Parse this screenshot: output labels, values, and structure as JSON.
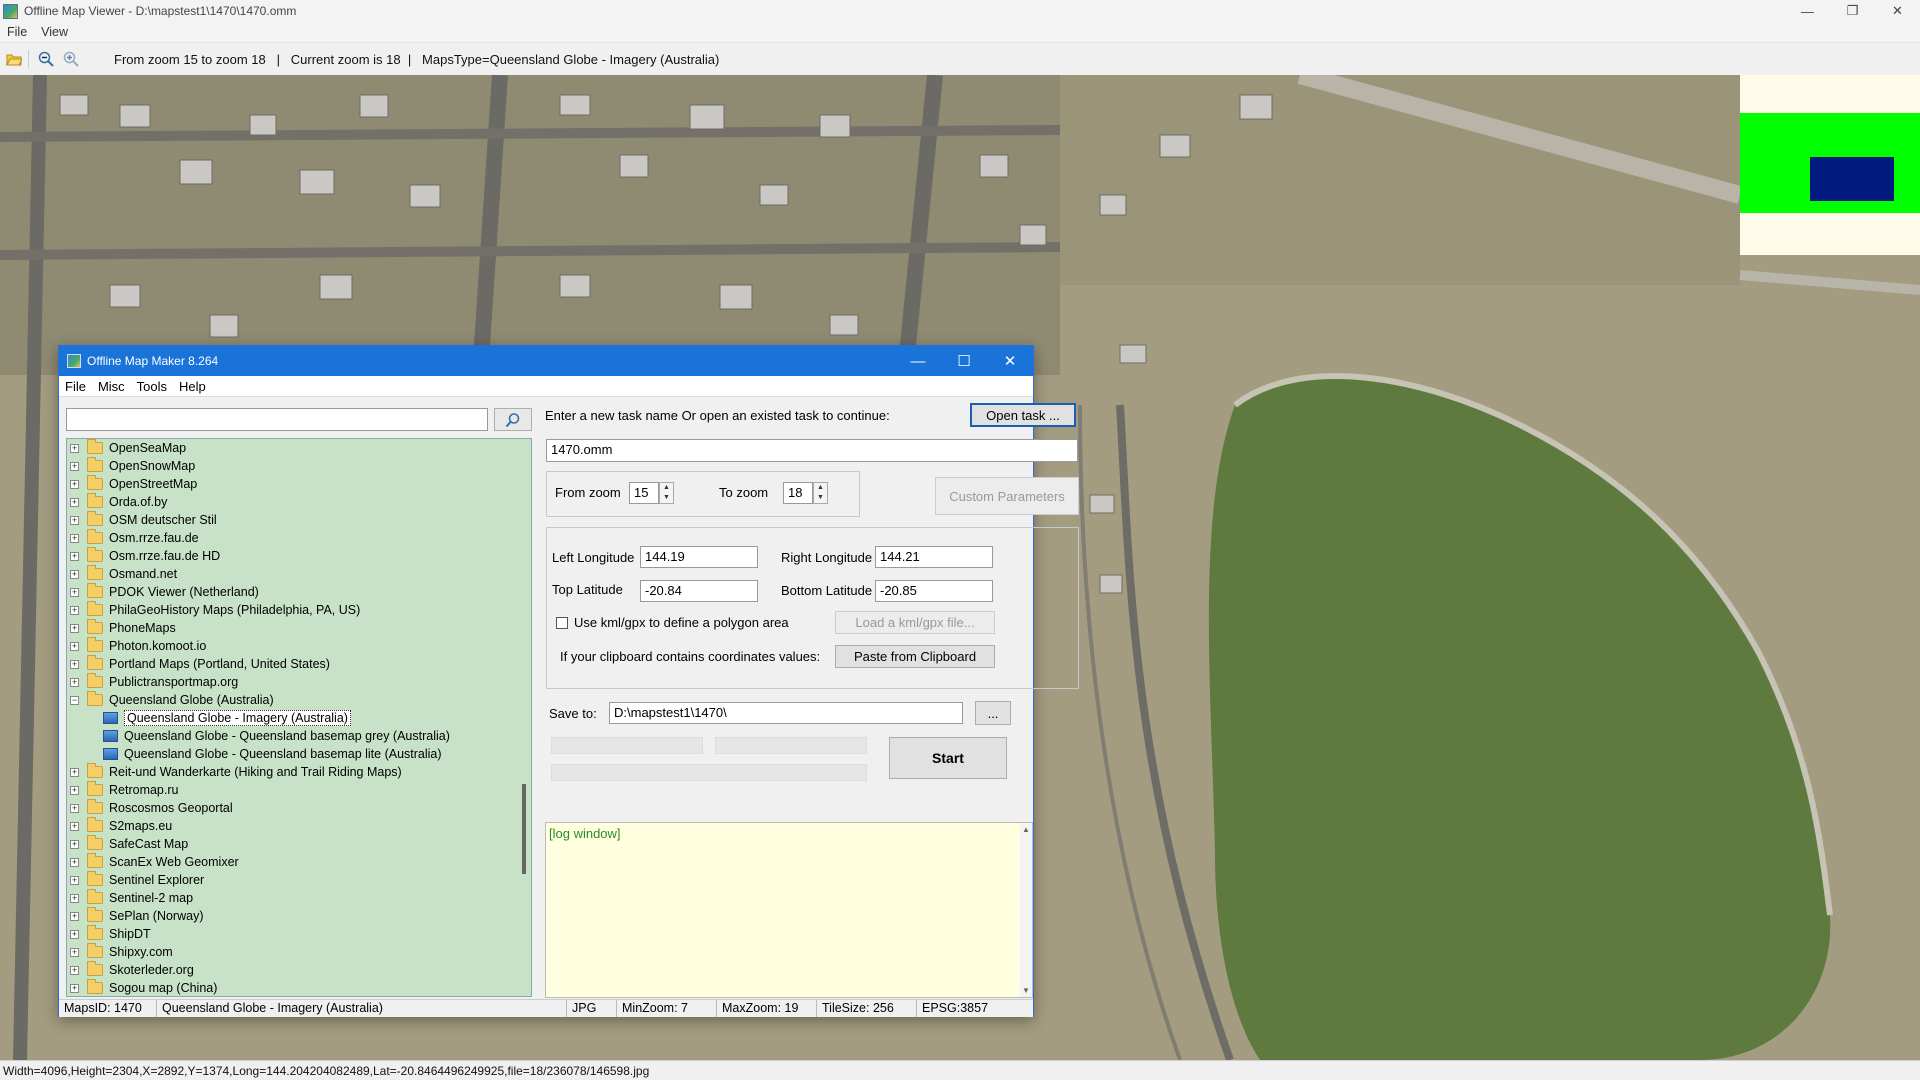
{
  "window": {
    "title": "Offline Map Viewer - D:\\mapstest1\\1470\\1470.omm"
  },
  "window_controls": {
    "minimize": "—",
    "maximize": "❐",
    "close": "✕"
  },
  "menu": [
    "File",
    "View"
  ],
  "toolbar": {
    "status": "From zoom 15 to zoom 18   |   Current zoom is 18  |   MapsType=Queensland Globe - Imagery (Australia)",
    "icons": [
      "open-folder-icon",
      "zoom-out-icon",
      "zoom-in-icon"
    ]
  },
  "statusbar": {
    "text": "Width=4096,Height=2304,X=2892,Y=1374,Long=144.204204082489,Lat=-20.8464496249925,file=18/236078/146598.jpg"
  },
  "dialog": {
    "title": "Offline Map Maker 8.264",
    "menu": [
      "File",
      "Misc",
      "Tools",
      "Help"
    ],
    "search": {
      "value": "",
      "placeholder": ""
    },
    "tree": {
      "items": [
        {
          "label": "OpenSeaMap",
          "expanded": false
        },
        {
          "label": "OpenSnowMap",
          "expanded": false
        },
        {
          "label": "OpenStreetMap",
          "expanded": false
        },
        {
          "label": "Orda.of.by",
          "expanded": false
        },
        {
          "label": "OSM deutscher Stil",
          "expanded": false
        },
        {
          "label": "Osm.rrze.fau.de",
          "expanded": false
        },
        {
          "label": "Osm.rrze.fau.de HD",
          "expanded": false
        },
        {
          "label": "Osmand.net",
          "expanded": false
        },
        {
          "label": "PDOK Viewer (Netherland)",
          "expanded": false
        },
        {
          "label": "PhilaGeoHistory Maps (Philadelphia, PA, US)",
          "expanded": false
        },
        {
          "label": "PhoneMaps",
          "expanded": false
        },
        {
          "label": "Photon.komoot.io",
          "expanded": false
        },
        {
          "label": "Portland Maps (Portland, United States)",
          "expanded": false
        },
        {
          "label": "Publictransportmap.org",
          "expanded": false
        },
        {
          "label": "Queensland Globe (Australia)",
          "expanded": true,
          "children": [
            {
              "label": "Queensland Globe - Imagery (Australia)",
              "selected": true
            },
            {
              "label": "Queensland Globe - Queensland basemap grey (Australia)",
              "selected": false
            },
            {
              "label": "Queensland Globe - Queensland basemap lite (Australia)",
              "selected": false
            }
          ]
        },
        {
          "label": "Reit-und Wanderkarte (Hiking and Trail Riding Maps)",
          "expanded": false
        },
        {
          "label": "Retromap.ru",
          "expanded": false
        },
        {
          "label": "Roscosmos Geoportal",
          "expanded": false
        },
        {
          "label": "S2maps.eu",
          "expanded": false
        },
        {
          "label": "SafeCast Map",
          "expanded": false
        },
        {
          "label": "ScanEx Web Geomixer",
          "expanded": false
        },
        {
          "label": "Sentinel Explorer",
          "expanded": false
        },
        {
          "label": "Sentinel-2 map",
          "expanded": false
        },
        {
          "label": "SePlan (Norway)",
          "expanded": false
        },
        {
          "label": "ShipDT",
          "expanded": false
        },
        {
          "label": "Shipxy.com",
          "expanded": false
        },
        {
          "label": "Skoterleder.org",
          "expanded": false
        },
        {
          "label": "Sogou map (China)",
          "expanded": false
        }
      ]
    },
    "task": {
      "prompt": "Enter a new task name Or open an existed task to continue:",
      "open_button": "Open task ...",
      "name_value": "1470.omm"
    },
    "zoom": {
      "from_label": "From zoom",
      "from_value": "15",
      "to_label": "To zoom",
      "to_value": "18",
      "custom_button": "Custom Parameters"
    },
    "coords": {
      "left_lon_label": "Left Longitude",
      "left_lon_value": "144.19",
      "right_lon_label": "Right Longitude",
      "right_lon_value": "144.21",
      "top_lat_label": "Top Latitude",
      "top_lat_value": "-20.84",
      "bottom_lat_label": "Bottom Latitude",
      "bottom_lat_value": "-20.85",
      "kml_label": "Use kml/gpx to define a polygon area",
      "kml_checked": false,
      "kml_button": "Load a kml/gpx file...",
      "clipboard_label": "If your clipboard contains coordinates values:",
      "clipboard_button": "Paste from Clipboard"
    },
    "save": {
      "label": "Save to:",
      "value": "D:\\mapstest1\\1470\\",
      "browse_button": "...",
      "start_button": "Start"
    },
    "log": {
      "text": "[log window]"
    },
    "status": {
      "maps_id": "MapsID: 1470",
      "map_name": "Queensland Globe - Imagery (Australia)",
      "format": "JPG",
      "min_zoom": "MinZoom: 7",
      "max_zoom": "MaxZoom: 19",
      "tile_size": "TileSize: 256",
      "epsg": "EPSG:3857"
    }
  },
  "colors": {
    "dialog_title_bg": "#1a73d9",
    "tree_bg": "#c8e2c7",
    "log_bg": "#ffffdf",
    "log_text": "#2c8a2c",
    "minimap_green": "#00ff00",
    "minimap_blue": "#001a80",
    "lake": "#5e7a3e"
  }
}
